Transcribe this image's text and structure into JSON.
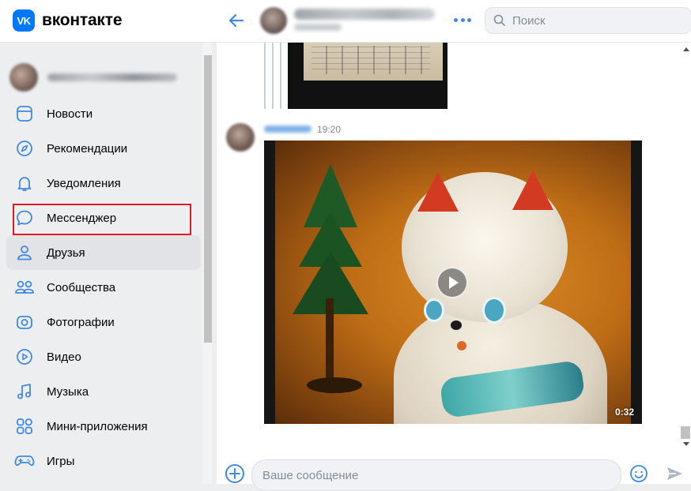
{
  "header": {
    "logo_mark": "VK",
    "logo_text": "вконтакте",
    "search_placeholder": "Поиск"
  },
  "sidebar": {
    "items": [
      {
        "label": "Новости",
        "icon": "news-icon"
      },
      {
        "label": "Рекомендации",
        "icon": "compass-icon"
      },
      {
        "label": "Уведомления",
        "icon": "bell-icon"
      },
      {
        "label": "Мессенджер",
        "icon": "chat-bubble-icon"
      },
      {
        "label": "Друзья",
        "icon": "user-icon"
      },
      {
        "label": "Сообщества",
        "icon": "users-icon"
      },
      {
        "label": "Фотографии",
        "icon": "camera-icon"
      },
      {
        "label": "Видео",
        "icon": "play-circle-icon"
      },
      {
        "label": "Музыка",
        "icon": "music-note-icon"
      },
      {
        "label": "Мини-приложения",
        "icon": "apps-icon"
      },
      {
        "label": "Игры",
        "icon": "gamepad-icon"
      }
    ],
    "active_item": "Друзья",
    "highlighted_item": "Мессенджер"
  },
  "chat": {
    "message_time": "19:20",
    "video_duration": "0:32"
  },
  "composer": {
    "placeholder": "Ваше сообщение"
  },
  "colors": {
    "accent": "#3f8ae0",
    "brand": "#0077ff",
    "highlight": "#e01b24"
  }
}
